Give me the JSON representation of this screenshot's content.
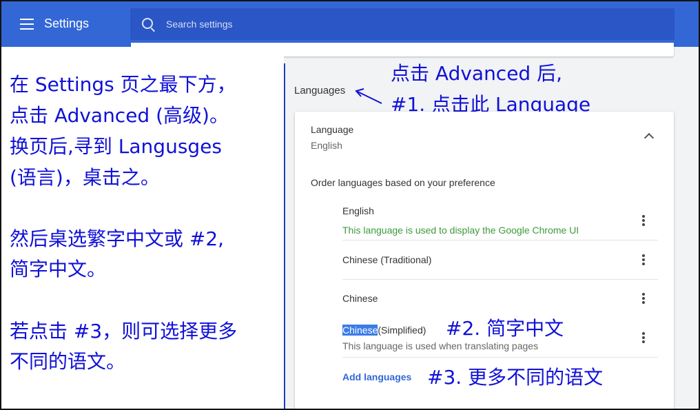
{
  "header": {
    "title": "Settings",
    "search_placeholder": "Search settings"
  },
  "left_annotation": {
    "lines": [
      " 在 Settings 页之最下方，",
      "点击 Advanced (高级)。",
      "换页后,寻到 Langusges",
      "(语言)，桌击之。",
      "然后桌选繁字中文或 #2,",
      "简字中文。",
      "若点击 #3，则可选择更多",
      "不同的语文。"
    ]
  },
  "annotations": {
    "step1_line1": "点击 Advanced 后,",
    "step1_line2": "#1. 点击此 Language",
    "step2": "#2. 简字中文",
    "step3": "#3. 更多不同的语文"
  },
  "languages_section": {
    "title": "Languages",
    "language_label": "Language",
    "language_value": "English",
    "order_text": "Order languages based on your preference",
    "items": [
      {
        "name": "English",
        "note": "This language is used to display the Google Chrome UI"
      },
      {
        "name": "Chinese (Traditional)"
      },
      {
        "name": "Chinese"
      },
      {
        "name_highlight": "Chinese",
        "name_rest": "(Simplified)",
        "note": "This language is used when translating pages"
      }
    ],
    "add_languages": "Add languages"
  },
  "colors": {
    "header_blue": "#3367d6",
    "annotation_blue": "#1010d8",
    "ui_note_green": "#3c9a3c",
    "link_blue": "#3367d6"
  }
}
